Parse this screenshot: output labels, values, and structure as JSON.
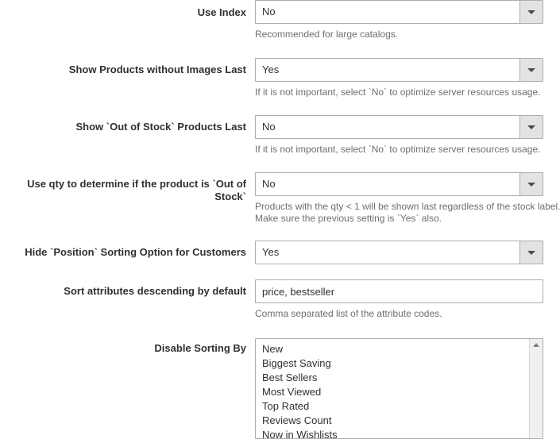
{
  "form": {
    "rows": [
      {
        "label": "Use Index",
        "control": "select",
        "value": "No",
        "note": "Recommended for large catalogs."
      },
      {
        "label": "Show Products without Images Last",
        "control": "select",
        "value": "Yes",
        "note": "If it is not important, select `No` to optimize server resources usage."
      },
      {
        "label": "Show `Out of Stock` Products Last",
        "control": "select",
        "value": "No",
        "note": "If it is not important, select `No` to optimize server resources usage."
      },
      {
        "label": "Use qty to determine if the product is `Out of Stock`",
        "label_line1": "Use qty to determine if the product is `Out of",
        "label_line2": "Stock`",
        "control": "select",
        "value": "No",
        "note": "Products with the qty < 1 will be shown last regardless of the stock label.\nMake sure the previous setting is `Yes` also."
      },
      {
        "label": "Hide `Position` Sorting Option for Customers",
        "control": "select",
        "value": "Yes",
        "note": ""
      },
      {
        "label": "Sort attributes descending by default",
        "control": "text",
        "value": "price, bestseller",
        "placeholder": "",
        "note": "Comma separated list of the attribute codes."
      },
      {
        "label": "Disable Sorting By",
        "control": "multiselect",
        "options": [
          "New",
          "Biggest Saving",
          "Best Sellers",
          "Most Viewed",
          "Top Rated",
          "Reviews Count",
          "Now in Wishlists"
        ],
        "note": ""
      }
    ],
    "icons": {
      "select_caret": "chevron-down-icon",
      "scroll_up": "scroll-up-arrow-icon"
    },
    "colors": {
      "label_text": "#303030",
      "note_text": "#6e6e6e",
      "border": "#adadad",
      "arrow_button_bg": "#e3e3e3",
      "scrollbar_track": "#f0f0f0",
      "background": "#ffffff"
    }
  }
}
